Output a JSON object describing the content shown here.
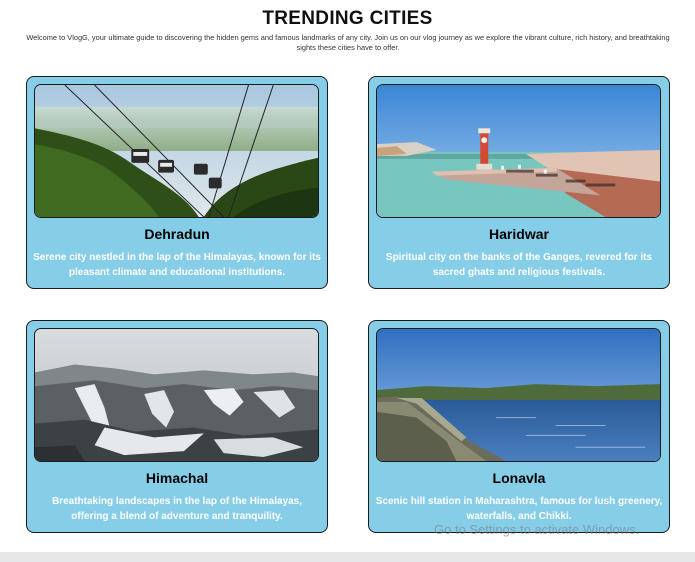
{
  "header": {
    "title": "TRENDING CITIES",
    "intro": "Welcome to VlogG, your ultimate guide to discovering the hidden gems and famous landmarks of any city. Join us on our vlog journey as we explore the vibrant culture, rich history, and breathtaking sights these cities have to offer."
  },
  "cities": [
    {
      "name": "Dehradun",
      "description": "Serene city nestled in the lap of the Himalayas, known for its pleasant climate and educational institutions.",
      "image": "ropeway-cable-car-photo"
    },
    {
      "name": "Haridwar",
      "description": "Spiritual city on the banks of the Ganges, revered for its sacred ghats and religious festivals.",
      "image": "river-ghat-clock-tower-photo"
    },
    {
      "name": "Himachal",
      "description": "Breathtaking landscapes in the lap of the Himalayas, offering a blend of adventure and tranquility.",
      "image": "snowy-mountains-photo"
    },
    {
      "name": "Lonavla",
      "description": "Scenic hill station in Maharashtra, famous for lush greenery, waterfalls, and Chikki.",
      "image": "lake-dam-wall-photo"
    }
  ],
  "overlay": {
    "activate_windows": "Go to Settings to activate Windows."
  },
  "colors": {
    "card_background": "#86cde8",
    "card_border": "#1a1a1a",
    "card_text": "#ffffff"
  }
}
